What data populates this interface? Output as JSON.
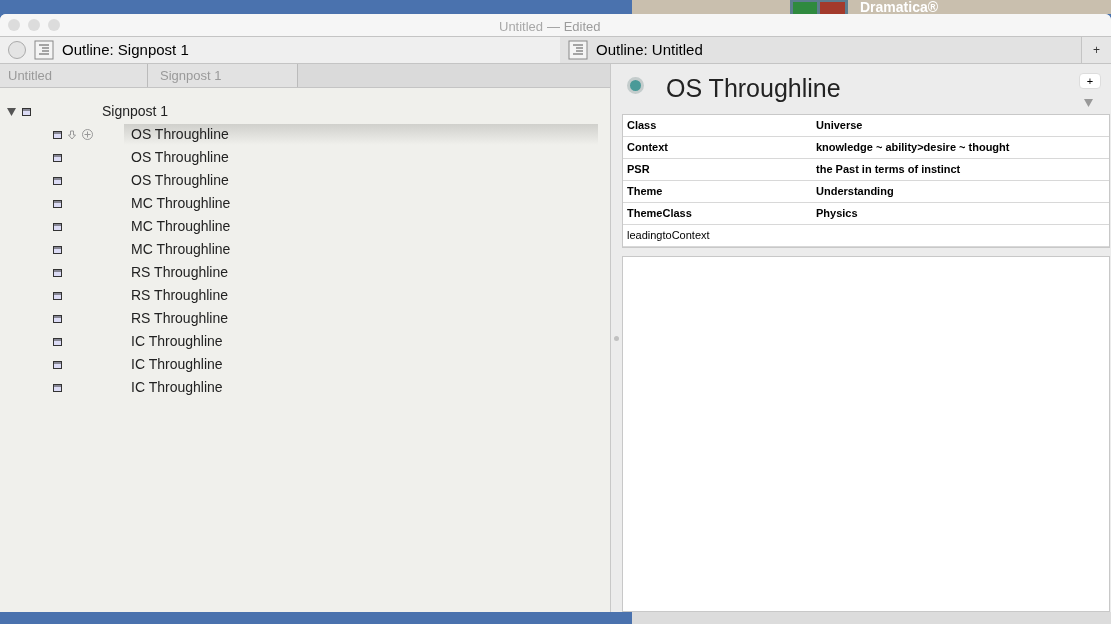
{
  "background_window": {
    "logo_text": "Dramatica®"
  },
  "window": {
    "title": "Untitled",
    "edited": "— Edited"
  },
  "tabs": [
    {
      "label": "Outline: Signpost 1",
      "selected": true
    },
    {
      "label": "Outline: Untitled",
      "selected": false
    }
  ],
  "add_tab": "+",
  "breadcrumbs": [
    "Untitled",
    "Signpost 1"
  ],
  "outline": {
    "title": "Signpost 1",
    "expanded": true,
    "children": [
      {
        "title": "OS Throughline",
        "selected": true
      },
      {
        "title": "OS Throughline",
        "selected": false
      },
      {
        "title": "OS Throughline",
        "selected": false
      },
      {
        "title": "MC Throughline",
        "selected": false
      },
      {
        "title": "MC Throughline",
        "selected": false
      },
      {
        "title": "MC Throughline",
        "selected": false
      },
      {
        "title": "RS Throughline",
        "selected": false
      },
      {
        "title": "RS Throughline",
        "selected": false
      },
      {
        "title": "RS Throughline",
        "selected": false
      },
      {
        "title": "IC Throughline",
        "selected": false
      },
      {
        "title": "IC Throughline",
        "selected": false
      },
      {
        "title": "IC Throughline",
        "selected": false
      }
    ]
  },
  "inspector": {
    "title": "OS Throughline",
    "add": "+",
    "properties": [
      {
        "name": "Class",
        "value": "Universe",
        "bold": true
      },
      {
        "name": "Context",
        "value": "knowledge ~ ability>desire ~ thought",
        "bold": true
      },
      {
        "name": "PSR",
        "value": "the Past in terms of instinct",
        "bold": true
      },
      {
        "name": "Theme",
        "value": "Understanding",
        "bold": true
      },
      {
        "name": "ThemeClass",
        "value": "Physics",
        "bold": true
      },
      {
        "name": "leadingtoContext",
        "bold": false
      }
    ]
  }
}
